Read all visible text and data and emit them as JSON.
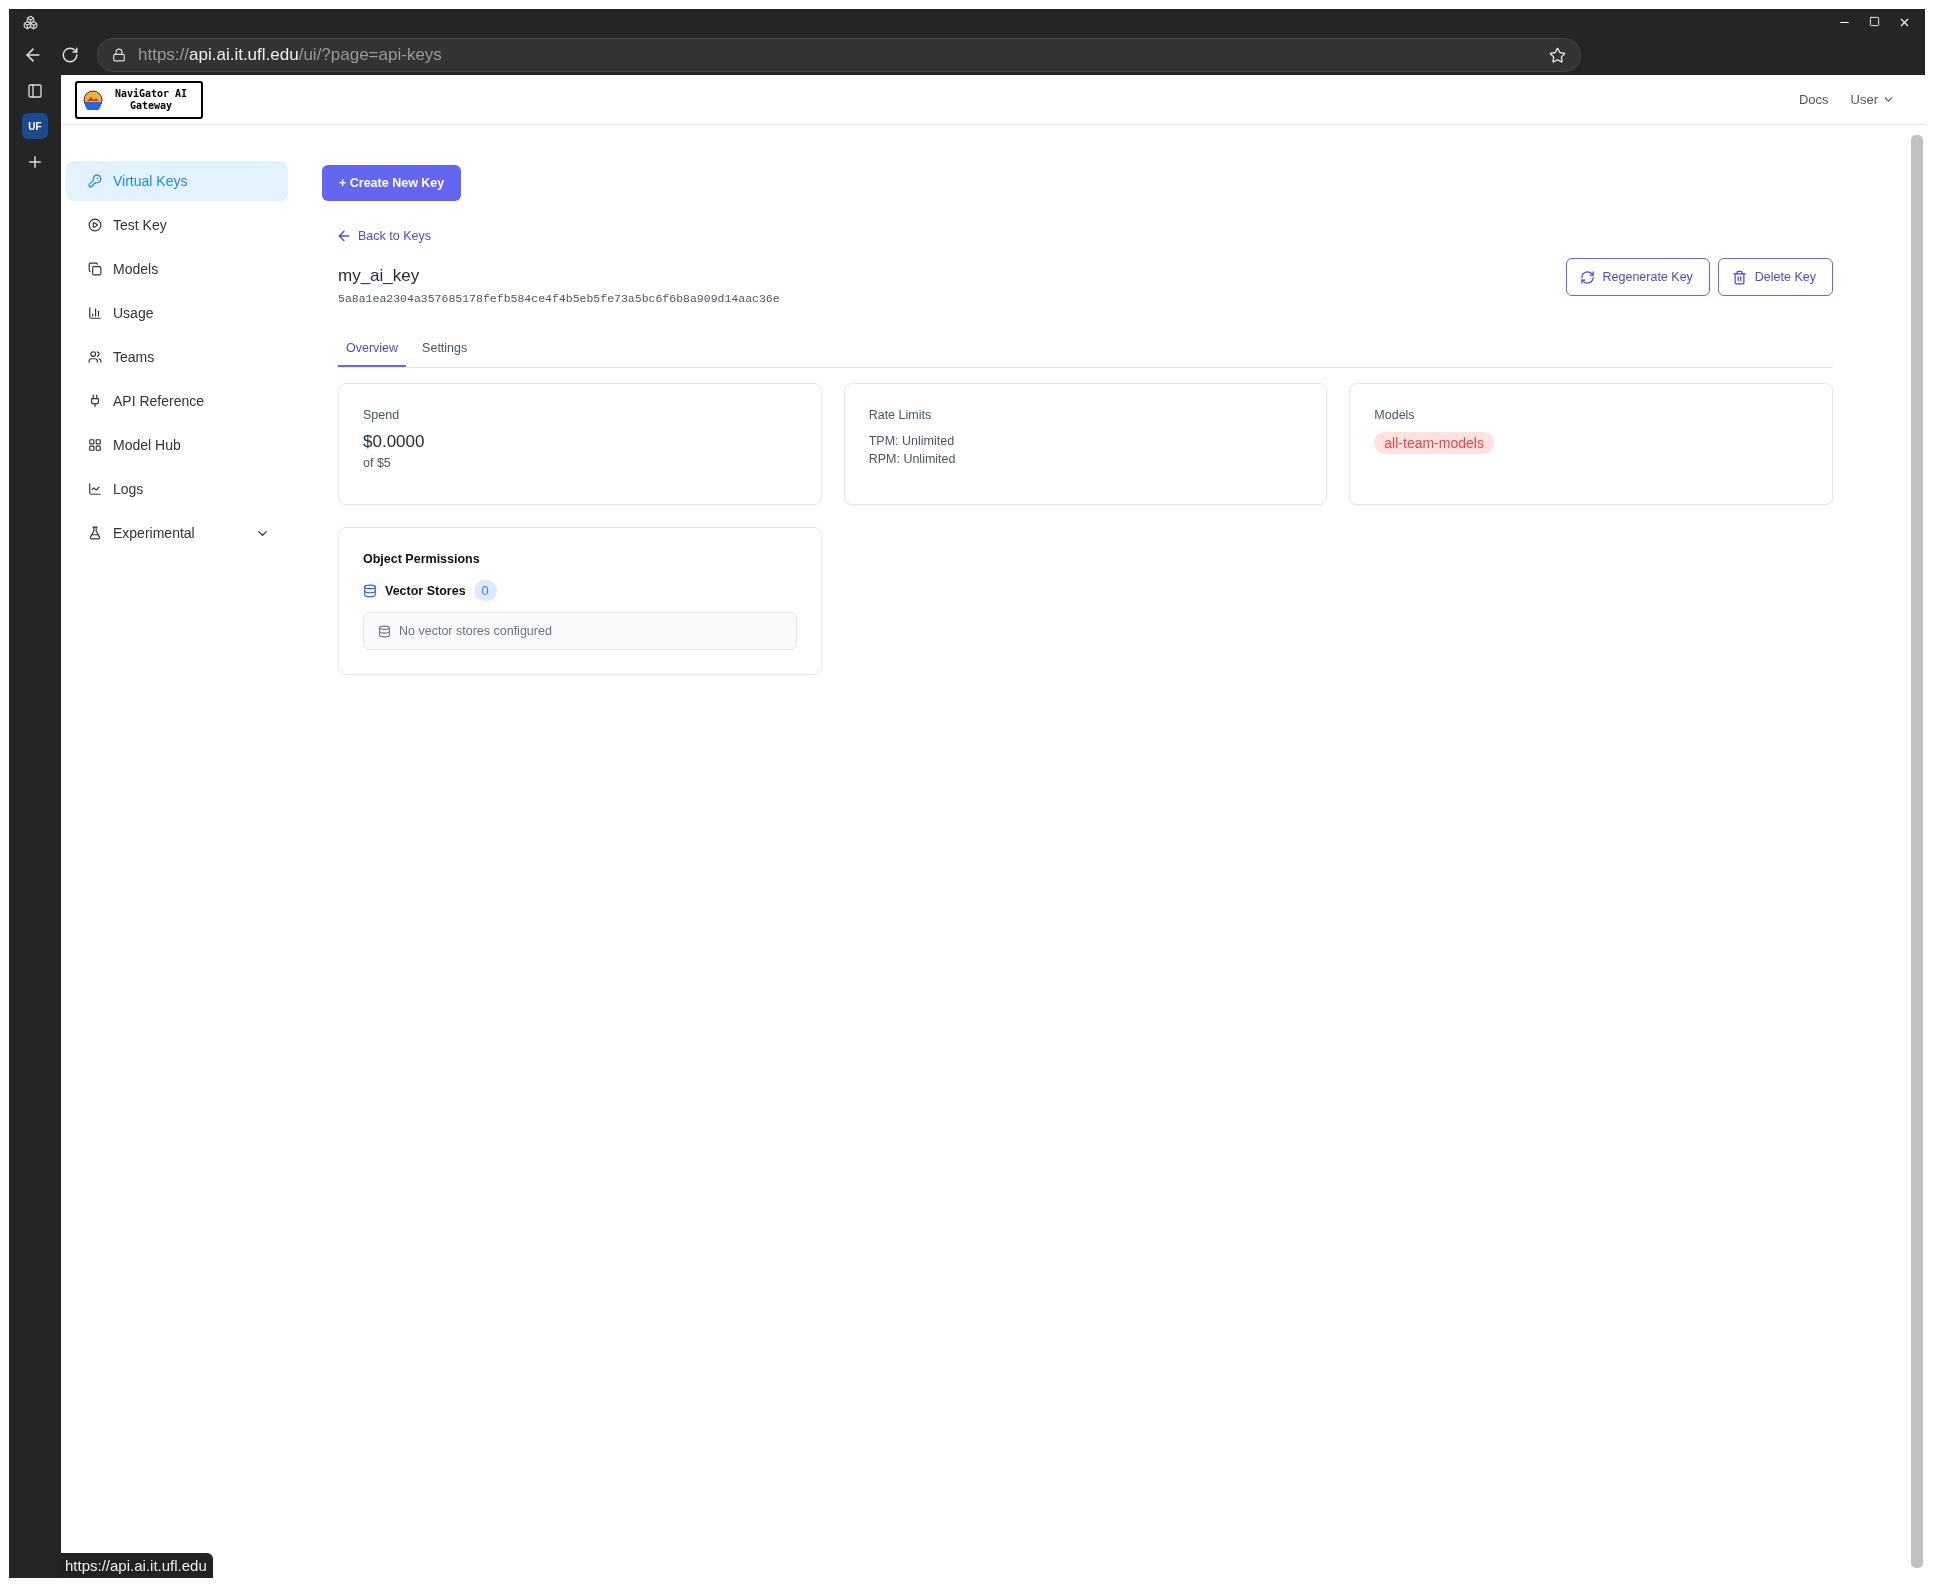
{
  "browser": {
    "address": {
      "scheme": "https://",
      "host": "api.ai.it.ufl.edu",
      "path": "/ui/?page=api-keys"
    },
    "status_url": "https://api.ai.it.ufl.edu",
    "rail_badge": "UF"
  },
  "header": {
    "logo": "NaviGator AI Gateway",
    "links": [
      {
        "label": "Docs",
        "kind": "link"
      },
      {
        "label": "User",
        "kind": "menu"
      }
    ]
  },
  "sidebar": {
    "items": [
      {
        "label": "Virtual Keys",
        "selected": true
      },
      {
        "label": "Test Key",
        "selected": false
      },
      {
        "label": "Models",
        "selected": false
      },
      {
        "label": "Usage",
        "selected": false
      },
      {
        "label": "Teams",
        "selected": false
      },
      {
        "label": "API Reference",
        "selected": false
      },
      {
        "label": "Model Hub",
        "selected": false
      },
      {
        "label": "Logs",
        "selected": false
      },
      {
        "label": "Experimental",
        "selected": false,
        "expanded": false
      }
    ]
  },
  "main": {
    "create_button": "+ Create New Key",
    "back_link": "Back to Keys",
    "key_name": "my_ai_key",
    "key_hash": "5a8a1ea2304a357685178fefb584ce4f4b5eb5fe73a5bc6f6b8a909d14aac36e",
    "actions": [
      {
        "label": "Regenerate Key",
        "kind": "regenerate"
      },
      {
        "label": "Delete Key",
        "kind": "delete"
      }
    ],
    "tabs": [
      {
        "label": "Overview",
        "selected": true
      },
      {
        "label": "Settings",
        "selected": false
      }
    ],
    "cards": [
      {
        "kind": "spend",
        "title": "Spend",
        "value": "$0.0000",
        "sub": "of $5"
      },
      {
        "kind": "lines",
        "title": "Rate Limits",
        "lines": [
          "TPM: Unlimited",
          "RPM: Unlimited"
        ]
      },
      {
        "kind": "tags",
        "title": "Models",
        "tags": [
          "all-team-models"
        ]
      }
    ],
    "permissions": {
      "title": "Object Permissions",
      "label": "Vector Stores",
      "count": "0",
      "empty": "No vector stores configured"
    }
  }
}
